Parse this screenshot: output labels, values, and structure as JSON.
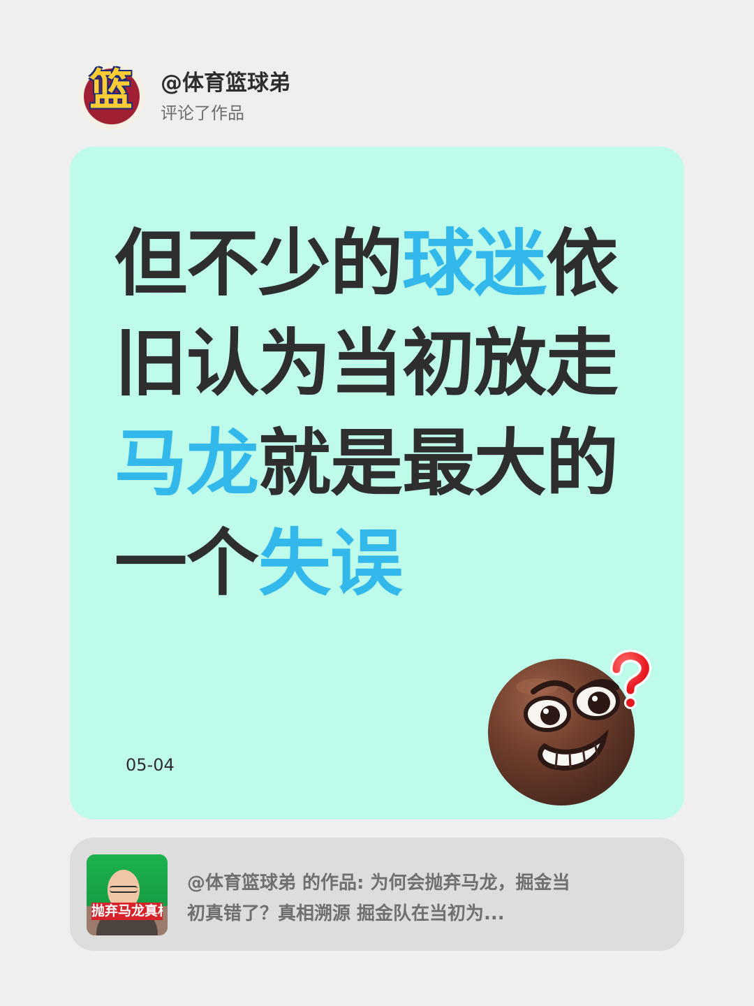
{
  "header": {
    "avatar_glyph": "篮",
    "username": "@体育篮球弟",
    "action": "评论了作品"
  },
  "comment": {
    "segments": [
      {
        "text": "但不少的",
        "highlight": false
      },
      {
        "text": "球迷",
        "highlight": true
      },
      {
        "text": "依旧认为当初放走",
        "highlight": false
      },
      {
        "text": "马龙",
        "highlight": true
      },
      {
        "text": "就是最大的一个",
        "highlight": false
      },
      {
        "text": "失误",
        "highlight": true
      }
    ],
    "date": "05-04",
    "emoji_icon": "grinning-question-face-icon"
  },
  "source": {
    "thumbnail_label": "抛弃马龙真相",
    "text": "@体育篮球弟  的作品: 为何会抛弃马龙，掘金当\n初真错了？真相溯源 掘金队在当初为...",
    "thumbnail_icon": "video-thumbnail-icon"
  },
  "colors": {
    "page_background": "#efefef",
    "comment_background": "#bffbea",
    "highlight": "#32b8ea",
    "source_background": "#dddddd",
    "text": "#2e2e2e"
  }
}
